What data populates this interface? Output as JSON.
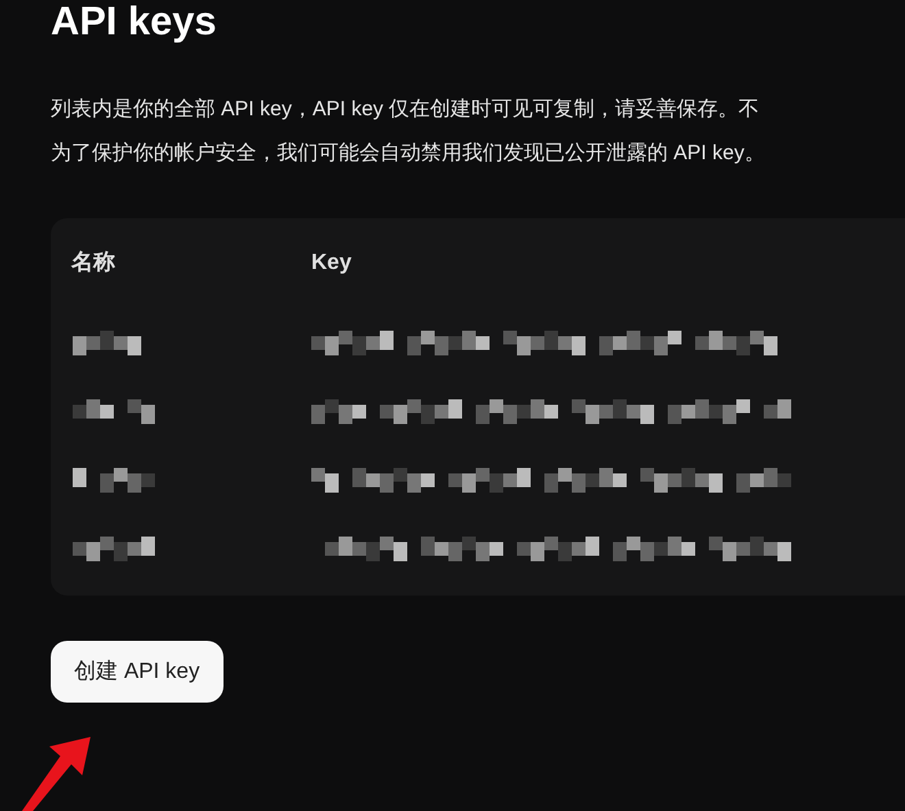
{
  "title": "API keys",
  "description": [
    "列表内是你的全部 API key，API key 仅在创建时可见可复制，请妥善保存。不",
    "为了保护你的帐户安全，我们可能会自动禁用我们发现已公开泄露的 API key。"
  ],
  "table": {
    "columns": [
      "名称",
      "Key"
    ],
    "rows": [
      {
        "kind": "redacted"
      },
      {
        "kind": "redacted"
      },
      {
        "kind": "redacted"
      },
      {
        "kind": "redacted"
      }
    ]
  },
  "create_button": "创建 API key"
}
